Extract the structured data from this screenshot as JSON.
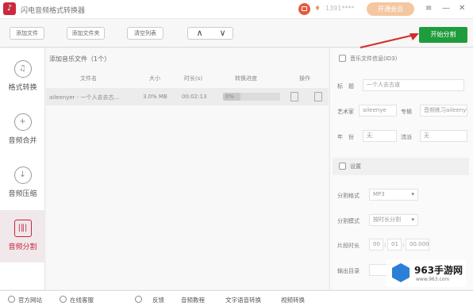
{
  "app": {
    "logo_glyph": "♪",
    "title": "闪电音频格式转换器",
    "username": "1391****",
    "vip_label": "开通会员",
    "accent": "#c7253e",
    "start_color": "#1f9c3c"
  },
  "window_controls": {
    "menu": "≡",
    "minimize": "—",
    "close": "✕"
  },
  "toolbar": {
    "add_file": "添加文件",
    "add_folder": "添加文件夹",
    "clear_list": "清空列表",
    "up": "∧",
    "down": "∨",
    "start": "开始分割"
  },
  "sidebar": {
    "items": [
      {
        "label": "格式转换",
        "icon": "format-convert-icon",
        "glyph": "♫"
      },
      {
        "label": "音频合并",
        "icon": "audio-merge-icon",
        "glyph": "+"
      },
      {
        "label": "音频压缩",
        "icon": "audio-compress-icon",
        "glyph": "↓"
      },
      {
        "label": "音频分割",
        "icon": "audio-split-icon",
        "glyph": "|‖|"
      }
    ]
  },
  "file_list": {
    "heading": "添加音乐文件（1个）",
    "columns": [
      "文件名",
      "大小",
      "时长(s)",
      "转换进度",
      "操作"
    ],
    "rows": [
      {
        "name": "aileenyer - 一个人去去古...",
        "size": "3.0% MB",
        "duration": "00:02:13",
        "progress_text": "0%",
        "progress": 0.3
      }
    ]
  },
  "id3": {
    "label": "音乐文件信息(ID3)",
    "title_label": "标　题",
    "title_value": "一个人去古道",
    "artist_label": "艺术家",
    "artist_value": "aileenye",
    "album_label": "专辑",
    "album_value": "音频练习aileenye",
    "year_label": "年　份",
    "year_value": "无",
    "genre_label": "流派",
    "genre_value": "无"
  },
  "settings": {
    "label": "设置",
    "format_label": "分割格式",
    "format_value": "MP3",
    "mode_label": "分割模式",
    "mode_value": "按时长分割",
    "duration_label": "片段时长",
    "h": "00",
    "m": "01",
    "s": "00.000",
    "output_label": "输出目录"
  },
  "statusbar": {
    "website": "官方网站",
    "support": "在线客服",
    "feedback": "反馈",
    "tutorial": "音频教程",
    "tts": "文字语音转换",
    "video": "视频转换"
  },
  "watermark": {
    "name": "963手游网",
    "url": "www.963.com"
  }
}
